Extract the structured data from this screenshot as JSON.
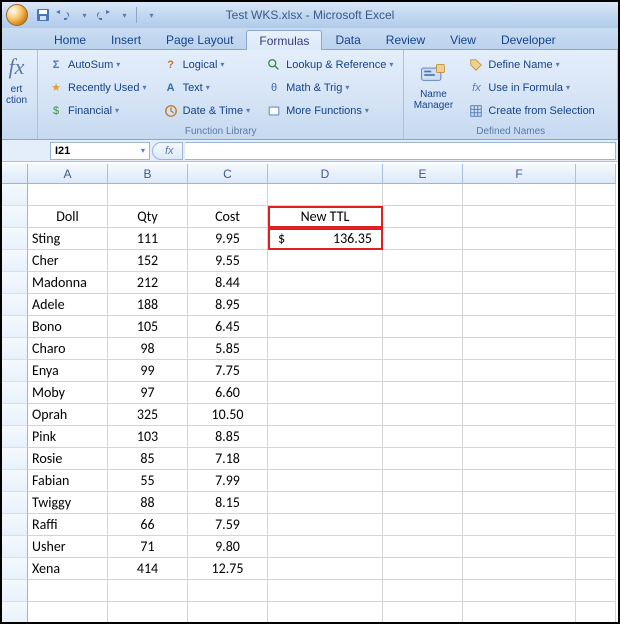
{
  "window": {
    "title": "Test WKS.xlsx - Microsoft Excel"
  },
  "qat": {
    "save": "save",
    "undo": "undo",
    "redo": "redo"
  },
  "tabs": {
    "home": "Home",
    "insert": "Insert",
    "page_layout": "Page Layout",
    "formulas": "Formulas",
    "data": "Data",
    "review": "Review",
    "view": "View",
    "developer": "Developer"
  },
  "ribbon": {
    "insert_function": {
      "partial_fx": "fx",
      "line1": "ert",
      "line2": "ction"
    },
    "autosum": "AutoSum",
    "recently_used": "Recently Used",
    "financial": "Financial",
    "logical": "Logical",
    "text": "Text",
    "date_time": "Date & Time",
    "lookup_ref": "Lookup & Reference",
    "math_trig": "Math & Trig",
    "more_functions": "More Functions",
    "function_library_label": "Function Library",
    "name_manager": "Name Manager",
    "name_manager_line1": "Name",
    "name_manager_line2": "Manager",
    "define_name": "Define Name",
    "use_in_formula": "Use in Formula",
    "create_selection": "Create from Selection",
    "defined_names_label": "Defined Names"
  },
  "namebox": {
    "ref": "I21"
  },
  "formula_bar": {
    "fx": "fx",
    "value": ""
  },
  "columns": {
    "widths": [
      80,
      80,
      80,
      115,
      80,
      113,
      40
    ],
    "labels": [
      "A",
      "B",
      "C",
      "D",
      "E",
      "F",
      ""
    ]
  },
  "sheet": {
    "header_row": {
      "a": "Doll",
      "b": "Qty",
      "c": "Cost",
      "d": "New TTL"
    },
    "ttl_currency": "$",
    "ttl_value": "136.35",
    "rows": [
      {
        "a": "Sting",
        "b": "111",
        "c": "9.95"
      },
      {
        "a": "Cher",
        "b": "152",
        "c": "9.55"
      },
      {
        "a": "Madonna",
        "b": "212",
        "c": "8.44"
      },
      {
        "a": "Adele",
        "b": "188",
        "c": "8.95"
      },
      {
        "a": "Bono",
        "b": "105",
        "c": "6.45"
      },
      {
        "a": "Charo",
        "b": "98",
        "c": "5.85"
      },
      {
        "a": "Enya",
        "b": "99",
        "c": "7.75"
      },
      {
        "a": "Moby",
        "b": "97",
        "c": "6.60"
      },
      {
        "a": "Oprah",
        "b": "325",
        "c": "10.50"
      },
      {
        "a": "Pink",
        "b": "103",
        "c": "8.85"
      },
      {
        "a": "Rosie",
        "b": "85",
        "c": "7.18"
      },
      {
        "a": "Fabian",
        "b": "55",
        "c": "7.99"
      },
      {
        "a": "Twiggy",
        "b": "88",
        "c": "8.15"
      },
      {
        "a": "Raffi",
        "b": "66",
        "c": "7.59"
      },
      {
        "a": "Usher",
        "b": "71",
        "c": "9.80"
      },
      {
        "a": "Xena",
        "b": "414",
        "c": "12.75"
      }
    ],
    "chart_data": {
      "type": "table",
      "columns": [
        "Doll",
        "Qty",
        "Cost",
        "New TTL"
      ],
      "data": [
        [
          "Sting",
          111,
          9.95,
          136.35
        ],
        [
          "Cher",
          152,
          9.55,
          null
        ],
        [
          "Madonna",
          212,
          8.44,
          null
        ],
        [
          "Adele",
          188,
          8.95,
          null
        ],
        [
          "Bono",
          105,
          6.45,
          null
        ],
        [
          "Charo",
          98,
          5.85,
          null
        ],
        [
          "Enya",
          99,
          7.75,
          null
        ],
        [
          "Moby",
          97,
          6.6,
          null
        ],
        [
          "Oprah",
          325,
          10.5,
          null
        ],
        [
          "Pink",
          103,
          8.85,
          null
        ],
        [
          "Rosie",
          85,
          7.18,
          null
        ],
        [
          "Fabian",
          55,
          7.99,
          null
        ],
        [
          "Twiggy",
          88,
          8.15,
          null
        ],
        [
          "Raffi",
          66,
          7.59,
          null
        ],
        [
          "Usher",
          71,
          9.8,
          null
        ],
        [
          "Xena",
          414,
          12.75,
          null
        ]
      ]
    }
  }
}
